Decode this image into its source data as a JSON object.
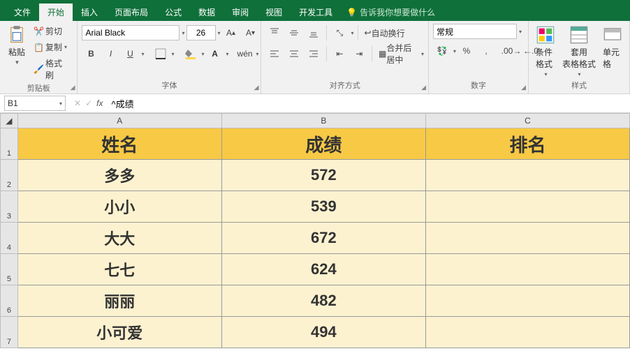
{
  "tabs": {
    "file": "文件",
    "home": "开始",
    "insert": "插入",
    "layout": "页面布局",
    "formula": "公式",
    "data": "数据",
    "review": "审阅",
    "view": "视图",
    "dev": "开发工具",
    "tell": "告诉我你想要做什么"
  },
  "ribbon": {
    "clipboard": {
      "label": "剪贴板",
      "paste": "粘贴",
      "cut": "剪切",
      "copy": "复制",
      "painter": "格式刷"
    },
    "font": {
      "label": "字体",
      "name": "Arial Black",
      "size": "26",
      "bold": "B",
      "italic": "I",
      "underline": "U",
      "wen": "wén"
    },
    "align": {
      "label": "对齐方式",
      "wrap": "自动换行",
      "merge": "合并后居中"
    },
    "number": {
      "label": "数字",
      "format": "常规"
    },
    "styles": {
      "label": "样式",
      "cond": "条件格式",
      "table": "套用\n表格格式",
      "cell": "单元格"
    }
  },
  "formulaBar": {
    "cellRef": "B1",
    "formula": "^成绩"
  },
  "columns": [
    "A",
    "B",
    "C"
  ],
  "chart_data": {
    "type": "table",
    "headers": [
      "姓名",
      "成绩",
      "排名"
    ],
    "rows": [
      {
        "name": "多多",
        "score": "572",
        "rank": ""
      },
      {
        "name": "小小",
        "score": "539",
        "rank": ""
      },
      {
        "name": "大大",
        "score": "672",
        "rank": ""
      },
      {
        "name": "七七",
        "score": "624",
        "rank": ""
      },
      {
        "name": "丽丽",
        "score": "482",
        "rank": ""
      },
      {
        "name": "小可爱",
        "score": "494",
        "rank": ""
      }
    ]
  }
}
